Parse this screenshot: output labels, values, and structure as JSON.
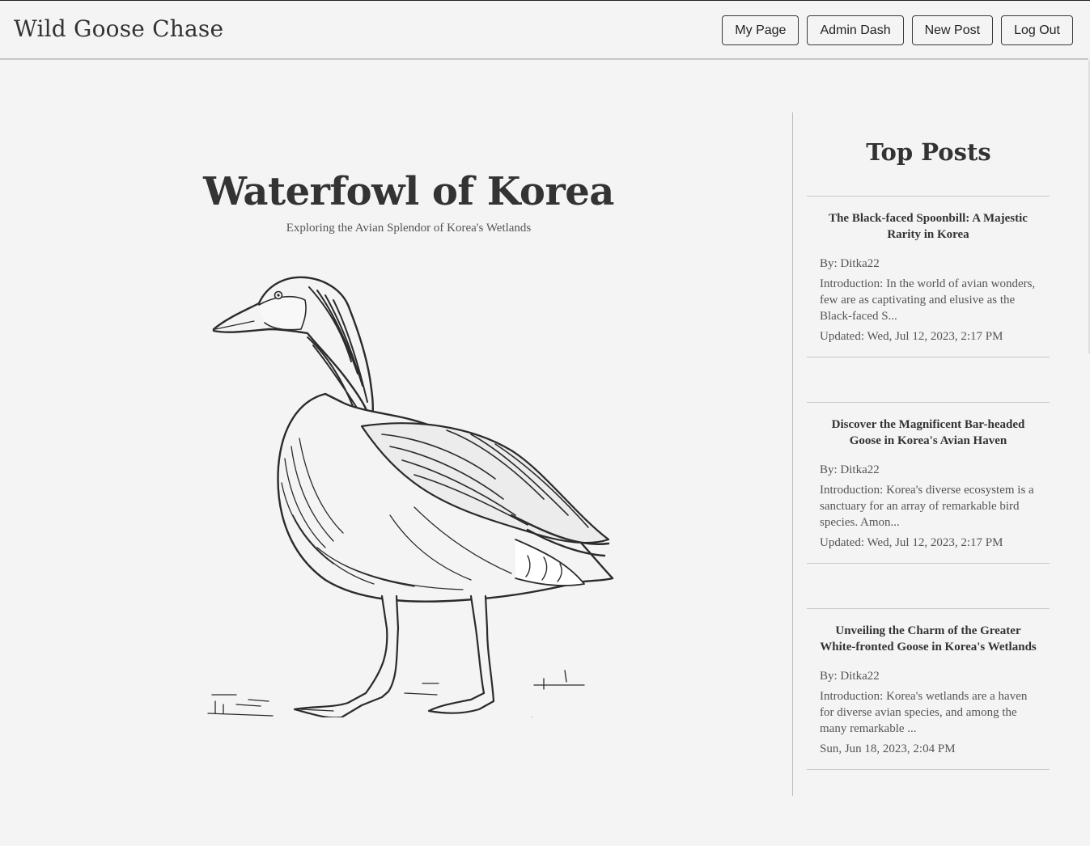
{
  "header": {
    "brand": "Wild Goose Chase",
    "nav": [
      "My Page",
      "Admin Dash",
      "New Post",
      "Log Out"
    ]
  },
  "hero": {
    "title": "Waterfowl of Korea",
    "subtitle": "Exploring the Avian Splendor of Korea's Wetlands",
    "image_icon": "goose-illustration"
  },
  "sidebar": {
    "title": "Top Posts",
    "posts": [
      {
        "title": "The Black-faced Spoonbill: A Majestic Rarity in Korea",
        "author": "By: Ditka22",
        "excerpt": "Introduction: In the world of avian wonders, few are as captivating and elusive as the Black-faced S...",
        "date": "Updated: Wed, Jul 12, 2023, 2:17 PM"
      },
      {
        "title": "Discover the Magnificent Bar-headed Goose in Korea's Avian Haven",
        "author": "By: Ditka22",
        "excerpt": "Introduction: Korea's diverse ecosystem is a sanctuary for an array of remarkable bird species. Amon...",
        "date": "Updated: Wed, Jul 12, 2023, 2:17 PM"
      },
      {
        "title": "Unveiling the Charm of the Greater White-fronted Goose in Korea's Wetlands",
        "author": "By: Ditka22",
        "excerpt": "Introduction: Korea's wetlands are a haven for diverse avian species, and among the many remarkable ...",
        "date": "Sun, Jun 18, 2023, 2:04 PM"
      }
    ]
  }
}
